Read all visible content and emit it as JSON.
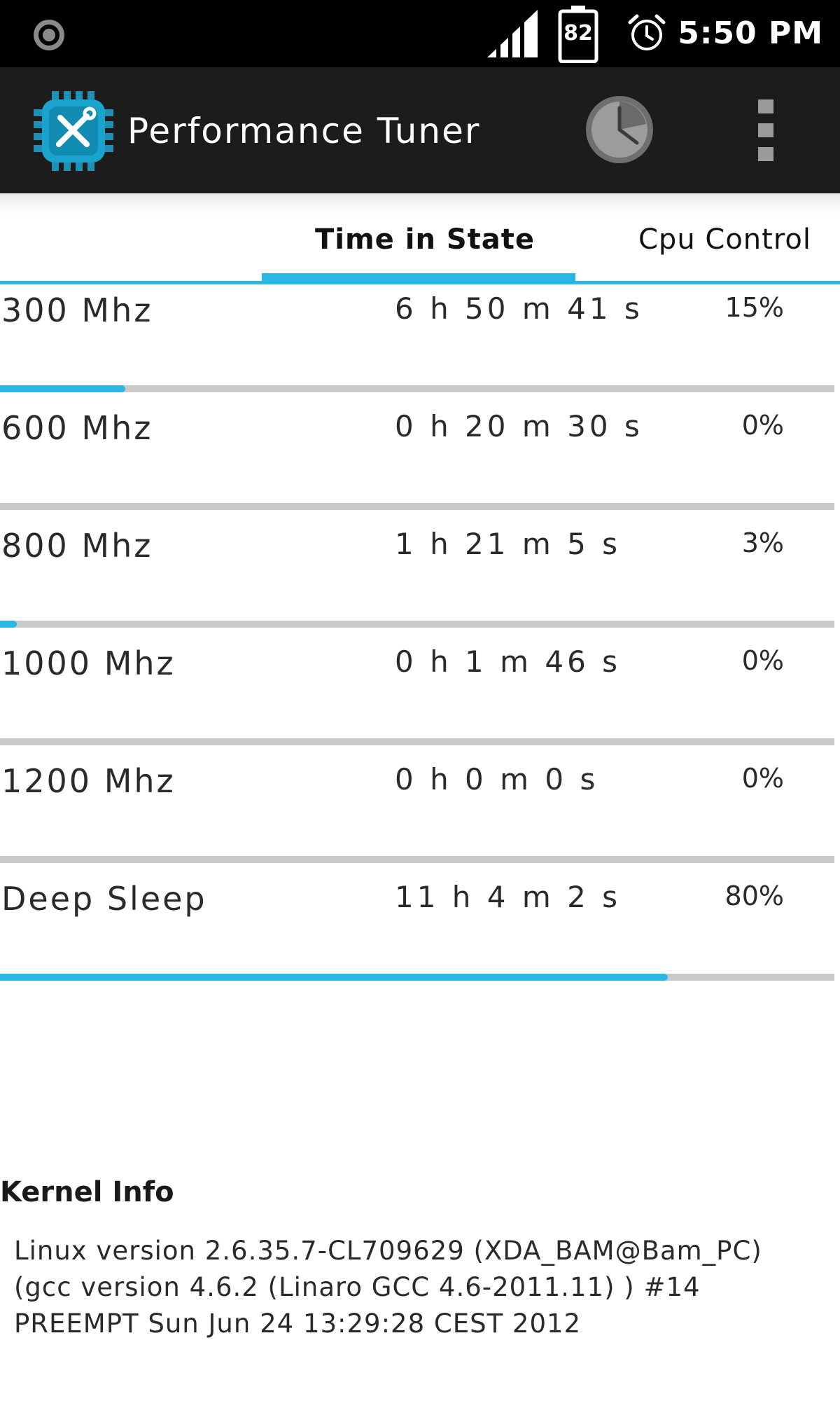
{
  "status_bar": {
    "left_icon": "record-icon",
    "signal_icon": "signal-icon",
    "battery_level": "82",
    "alarm_icon": "alarm-icon",
    "time": "5:50 PM"
  },
  "app_bar": {
    "logo_icon": "tools-chip-icon",
    "title": "Performance Tuner",
    "history_icon": "clock-icon",
    "overflow_icon": "more-vertical-icon"
  },
  "tabs": [
    {
      "label": "Time in State",
      "selected": true
    },
    {
      "label": "Cpu Control",
      "selected": false
    }
  ],
  "states": [
    {
      "name": "300 Mhz",
      "time": "6 h 50 m 41 s",
      "percent": "15%",
      "fraction": 0.15
    },
    {
      "name": "600 Mhz",
      "time": "0 h 20 m 30 s",
      "percent": "0%",
      "fraction": 0.0
    },
    {
      "name": "800 Mhz",
      "time": "1 h 21 m 5 s",
      "percent": "3%",
      "fraction": 0.02
    },
    {
      "name": "1000 Mhz",
      "time": "0 h 1 m 46 s",
      "percent": "0%",
      "fraction": 0.0
    },
    {
      "name": "1200 Mhz",
      "time": "0 h 0 m 0 s",
      "percent": "0%",
      "fraction": 0.0
    },
    {
      "name": "Deep Sleep",
      "time": "11 h 4 m 2 s",
      "percent": "80%",
      "fraction": 0.8
    }
  ],
  "kernel": {
    "title": "Kernel Info",
    "text": "Linux version 2.6.35.7-CL709629 (XDA_BAM@Bam_PC) (gcc version 4.6.2 (Linaro GCC 4.6-2011.11) ) #14 PREEMPT Sun Jun 24 13:29:28 CEST 2012"
  },
  "colors": {
    "accent": "#2bb7e4",
    "status_bar_bg": "#000000",
    "app_bar_bg": "#1c1c1c",
    "bar_track": "#c9c9c9"
  }
}
